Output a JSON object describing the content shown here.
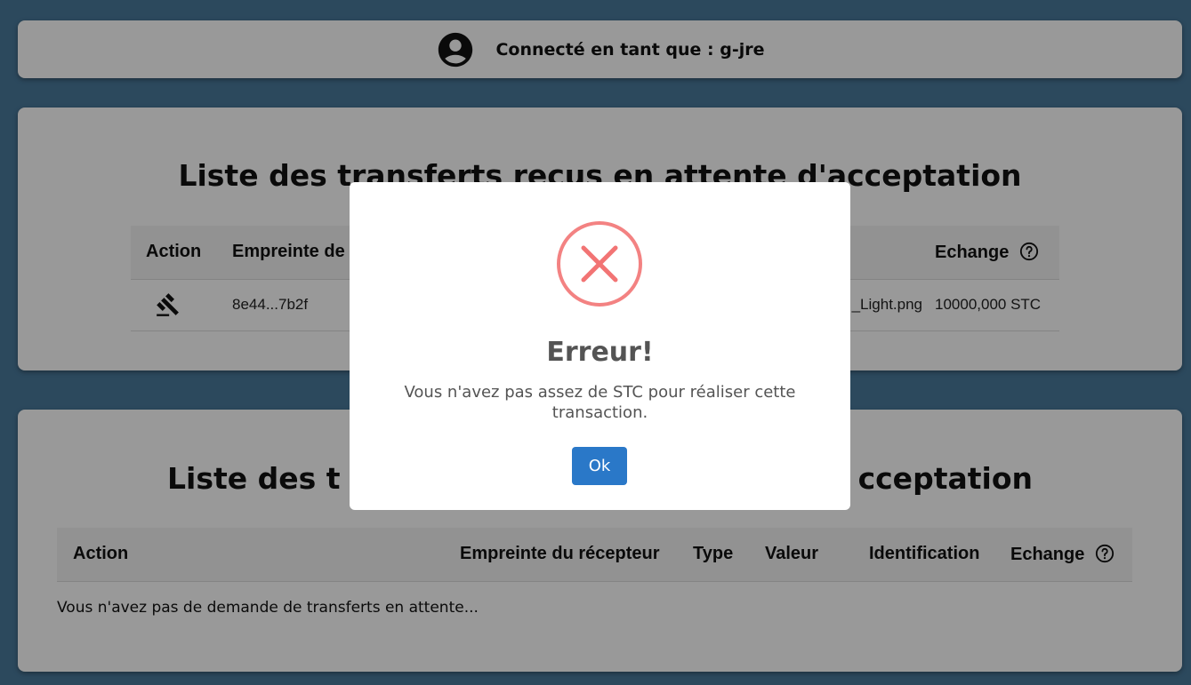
{
  "header": {
    "user_label": "Connecté en tant que : g-jre"
  },
  "received": {
    "title": "Liste des transferts reçus en attente d'acceptation",
    "columns": {
      "action": "Action",
      "fingerprint": "Empreinte de",
      "exchange": "Echange"
    },
    "rows": [
      {
        "fingerprint": "8e44...7b2f",
        "identification": "_Light.png",
        "exchange": "10000,000 STC"
      }
    ]
  },
  "sent": {
    "title_left": "Liste des t",
    "title_right": "cceptation",
    "columns": {
      "action": "Action",
      "receiver_fingerprint": "Empreinte du récepteur",
      "type": "Type",
      "value": "Valeur",
      "identification": "Identification",
      "exchange": "Echange"
    },
    "empty_message": "Vous n'avez pas de demande de transferts en attente..."
  },
  "modal": {
    "title": "Erreur!",
    "message": "Vous n'avez pas assez de STC pour réaliser cette transaction.",
    "ok_label": "Ok"
  },
  "colors": {
    "background": "#4a7a9c",
    "error": "#f27474",
    "primary_button": "#2a78c8",
    "modal_text": "#545454"
  },
  "icons": {
    "user": "account-circle-icon",
    "action": "gavel-icon",
    "help": "help-circle-icon",
    "error": "error-x-icon"
  }
}
